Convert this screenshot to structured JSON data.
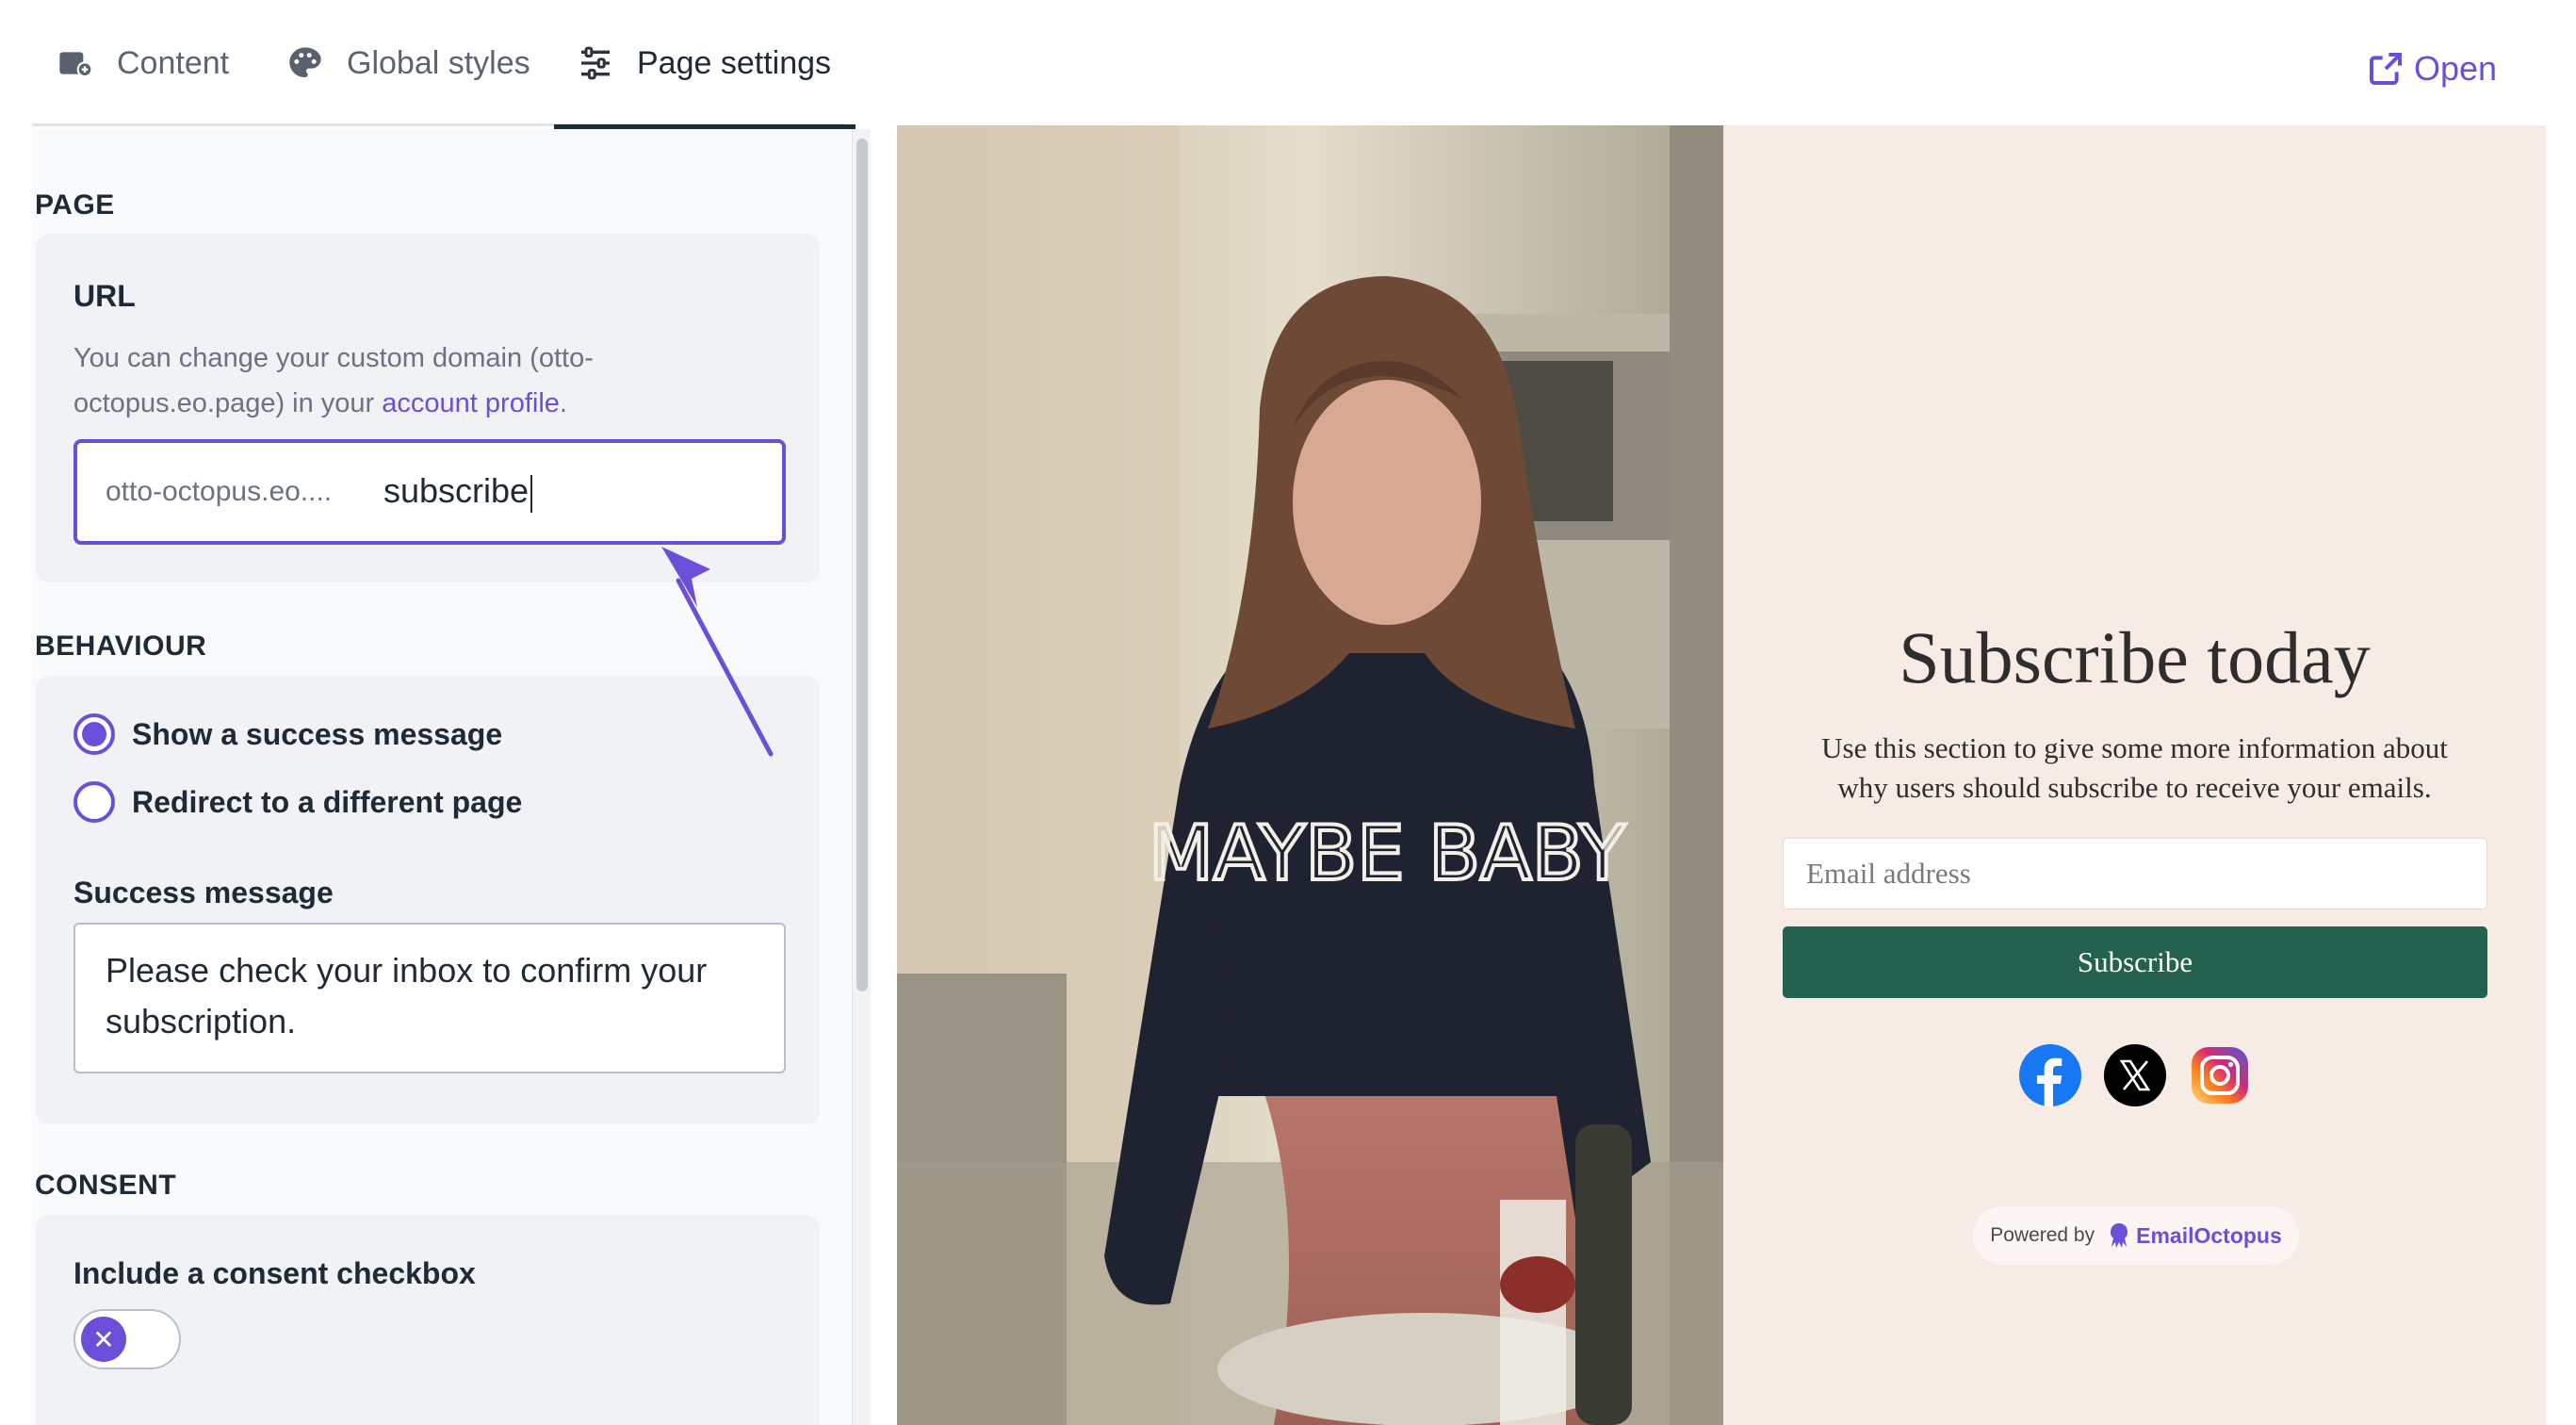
{
  "tabs": {
    "content": "Content",
    "global_styles": "Global styles",
    "page_settings": "Page settings"
  },
  "open_label": "Open",
  "page_section": {
    "label": "PAGE",
    "url_title": "URL",
    "help_prefix": "You can change your custom domain (otto-octopus.eo.page) in your ",
    "help_link": "account profile",
    "help_suffix": ".",
    "url_prefix": "otto-octopus.eo....",
    "url_slug": "subscribe"
  },
  "behaviour": {
    "label": "BEHAVIOUR",
    "option_success": "Show a success message",
    "option_redirect": "Redirect to a different page",
    "selected": "success",
    "success_label": "Success message",
    "success_message": "Please check your inbox to confirm your subscription."
  },
  "consent": {
    "label": "CONSENT",
    "checkbox_label": "Include a consent checkbox",
    "enabled": false,
    "toggle_glyph": "✕"
  },
  "preview": {
    "photo_text": "MAYBE BABY",
    "title": "Subscribe today",
    "description": "Use this section to give some more information about why users should subscribe to receive your emails.",
    "email_placeholder": "Email address",
    "button_label": "Subscribe",
    "socials": [
      "facebook-icon",
      "x-icon",
      "instagram-icon"
    ],
    "powered_by": "Powered by",
    "brand": "EmailOctopus"
  },
  "colors": {
    "accent": "#6b4fd8",
    "preview_background": "#f7ebe6",
    "button": "#25614f"
  }
}
